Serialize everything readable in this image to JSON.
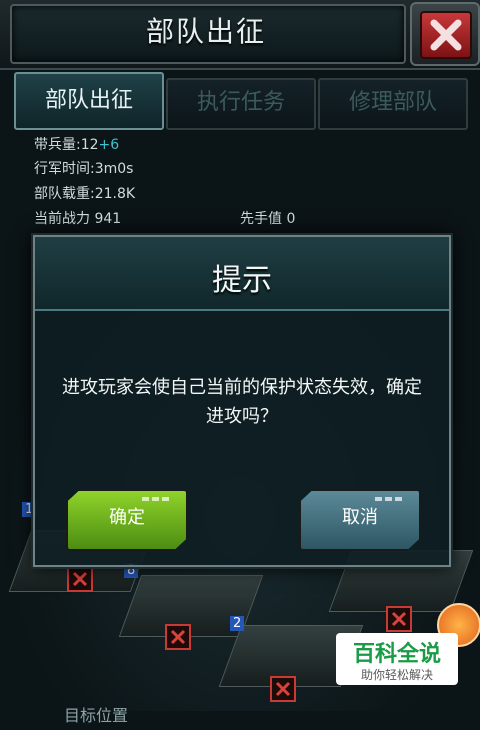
{
  "header": {
    "title": "部队出征"
  },
  "tabs": [
    {
      "label": "部队出征",
      "active": true
    },
    {
      "label": "执行任务",
      "active": false
    },
    {
      "label": "修理部队",
      "active": false
    }
  ],
  "info": {
    "troops_label": "带兵量:12",
    "troops_bonus": "+6",
    "march_time": "行军时间:3m0s",
    "load": "部队载重:21.8K",
    "power": "当前战力 941",
    "initiative": "先手值 0"
  },
  "scene": {
    "plane_numbers": [
      "1",
      "8",
      "2"
    ]
  },
  "dialog": {
    "title": "提示",
    "message": "进攻玩家会使自己当前的保护状态失效，确定进攻吗？",
    "confirm_label": "确定",
    "cancel_label": "取消"
  },
  "watermark": {
    "main": "百科全说",
    "sub": "助你轻松解决"
  },
  "footer": {
    "text": "目标位置"
  },
  "colors": {
    "accent": "#3fc1d1",
    "confirm": "#7cc424",
    "cancel": "#4a7886",
    "close": "#c8383a"
  }
}
